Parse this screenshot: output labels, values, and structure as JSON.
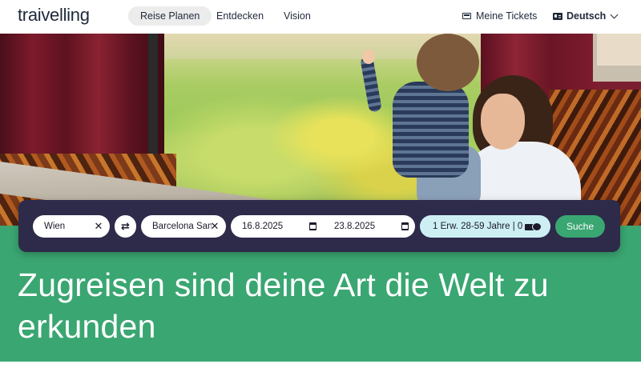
{
  "header": {
    "logo": "traivelling",
    "nav": [
      {
        "label": "Reise Planen",
        "active": true
      },
      {
        "label": "Entdecken",
        "active": false
      },
      {
        "label": "Vision",
        "active": false
      }
    ],
    "tickets_label": "Meine Tickets",
    "language_label": "Deutsch"
  },
  "hero": {
    "image_icon": "photo"
  },
  "search": {
    "from": "Wien",
    "to": "Barcelona Sants",
    "date_start": "16.8.2025",
    "date_end": "23.8.2025",
    "passengers": "1 Erw. 28-59 Jahre |  0",
    "search_label": "Suche",
    "clear_glyph": "✕",
    "swap_glyph": "⇄"
  },
  "headline": "Zugreisen sind deine Art die Welt zu erkunden",
  "colors": {
    "brand_green": "#3aa672",
    "search_bar": "#2d2a4a",
    "pax_field": "#cdeff4"
  }
}
